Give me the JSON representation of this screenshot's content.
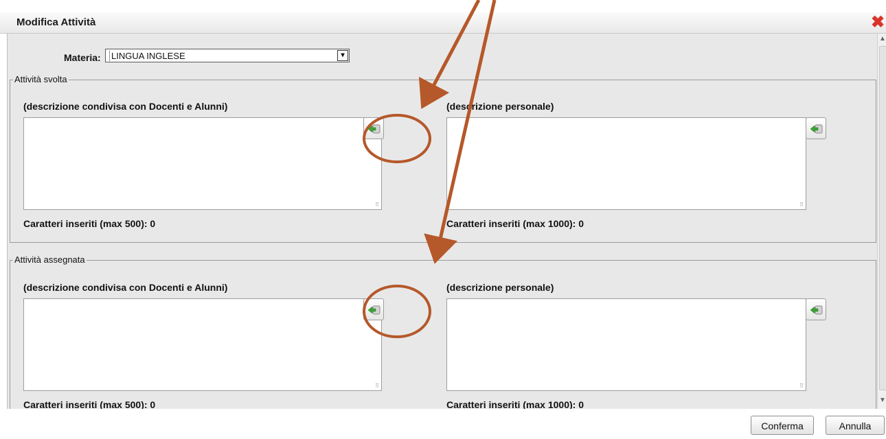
{
  "dialog": {
    "title": "Modifica Attività"
  },
  "materia": {
    "label": "Materia:",
    "value": "LINGUA INGLESE"
  },
  "svolta": {
    "legend": "Attività svolta",
    "shared_label": "(descrizione condivisa con Docenti e Alunni)",
    "personal_label": "(descrizione personale)",
    "shared_count": "Caratteri inseriti (max 500): 0",
    "personal_count": "Caratteri inseriti (max 1000): 0"
  },
  "assegnata": {
    "legend": "Attività assegnata",
    "shared_label": "(descrizione condivisa con Docenti e Alunni)",
    "personal_label": "(descrizione personale)",
    "shared_count": "Caratteri inseriti (max 500): 0",
    "personal_count": "Caratteri inseriti (max 1000): 0"
  },
  "buttons": {
    "confirm": "Conferma",
    "cancel": "Annulla"
  },
  "icons": {
    "close": "close-icon",
    "copy": "import-arrow-icon"
  },
  "colors": {
    "annotation": "#b5582a",
    "close": "#d9342b",
    "arrow_green": "#3aa335"
  }
}
